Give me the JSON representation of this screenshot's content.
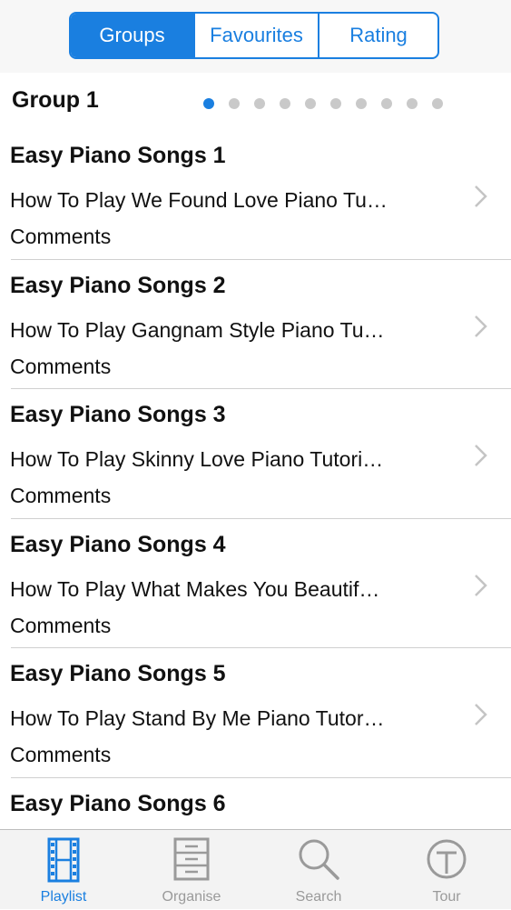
{
  "segmented": {
    "items": [
      {
        "label": "Groups",
        "selected": true
      },
      {
        "label": "Favourites",
        "selected": false
      },
      {
        "label": "Rating",
        "selected": false
      }
    ]
  },
  "group": {
    "title": "Group 1",
    "pages": 10,
    "current_page": 1
  },
  "rows": [
    {
      "title": "Easy Piano Songs 1",
      "subtitle": "How To Play We Found Love Piano Tu…",
      "comments": "Comments"
    },
    {
      "title": "Easy Piano Songs 2",
      "subtitle": "How To Play Gangnam Style Piano Tu…",
      "comments": "Comments"
    },
    {
      "title": "Easy Piano Songs 3",
      "subtitle": "How To Play Skinny Love Piano Tutori…",
      "comments": "Comments"
    },
    {
      "title": "Easy Piano Songs 4",
      "subtitle": "How To Play What Makes You Beautif…",
      "comments": "Comments"
    },
    {
      "title": "Easy Piano Songs 5",
      "subtitle": "How To Play Stand By Me Piano Tutor…",
      "comments": "Comments"
    },
    {
      "title": "Easy Piano Songs 6",
      "subtitle": "",
      "comments": ""
    }
  ],
  "tabbar": {
    "items": [
      {
        "label": "Playlist",
        "icon": "film-strip-icon",
        "active": true
      },
      {
        "label": "Organise",
        "icon": "file-cabinet-icon",
        "active": false
      },
      {
        "label": "Search",
        "icon": "magnifier-icon",
        "active": false
      },
      {
        "label": "Tour",
        "icon": "signpost-icon",
        "active": false
      }
    ]
  },
  "colors": {
    "accent": "#1a7fe0",
    "inactive_tab": "#9a9a9a",
    "inactive_dot": "#c9c9c9",
    "separator": "#d0d0d0"
  }
}
